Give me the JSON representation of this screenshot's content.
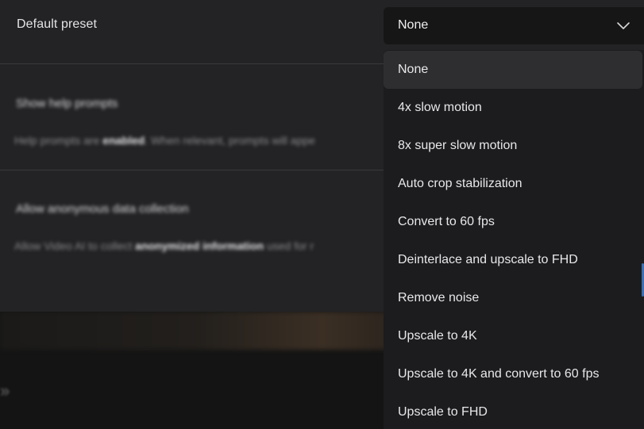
{
  "settings": {
    "default_preset_label": "Default preset",
    "help_prompts_heading": "Show help prompts",
    "help_prompts_desc_prefix": "Help prompts are ",
    "help_prompts_desc_bold": "enabled",
    "help_prompts_desc_suffix": ". When relevant, prompts will appe",
    "data_collection_heading": "Allow anonymous data collection",
    "data_collection_desc_prefix": "Allow Video AI to collect ",
    "data_collection_desc_bold": "anonymized information",
    "data_collection_desc_suffix": " used for r"
  },
  "preset_select": {
    "value": "None",
    "options": [
      "None",
      "4x slow motion",
      "8x super slow motion",
      "Auto crop stabilization",
      "Convert to 60 fps",
      "Deinterlace and upscale to FHD",
      "Remove noise",
      "Upscale to 4K",
      "Upscale to 4K and convert to 60 fps",
      "Upscale to FHD"
    ],
    "selected_index": 0
  },
  "icons": {
    "chevron": "chevron-down-icon",
    "background": "skip-forward-icon"
  },
  "colors": {
    "panel_bg": "#232325",
    "dropdown_bg": "#1c1c1e",
    "selected_bg": "#2e2e31",
    "scroll_accent": "#3d6fb3"
  }
}
